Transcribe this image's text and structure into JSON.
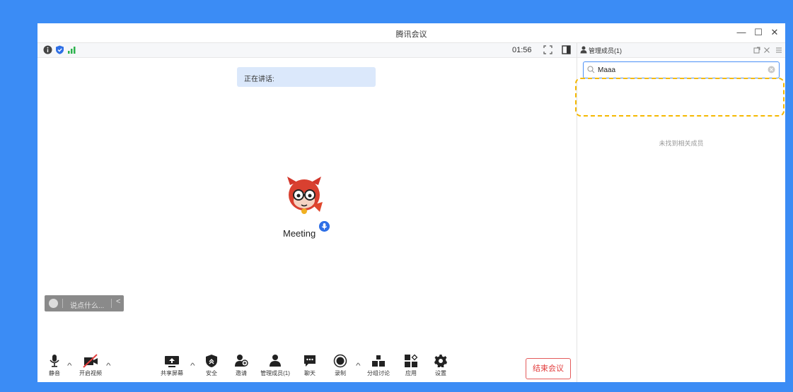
{
  "window": {
    "title": "腾讯会议",
    "controls": {
      "minimize": "—",
      "maximize": "☐",
      "close": "✕"
    }
  },
  "statusbar": {
    "timer": "01:56"
  },
  "speaking": {
    "label": "正在讲话:"
  },
  "participant": {
    "name": "Meeting"
  },
  "chat": {
    "placeholder": "说点什么...",
    "collapse": "<"
  },
  "toolbar": {
    "mute": "静音",
    "video": "开启视频",
    "share": "共享屏幕",
    "security": "安全",
    "invite": "邀请",
    "members": "管理成员(1)",
    "chat": "聊天",
    "record": "录制",
    "breakout": "分组讨论",
    "apps": "应用",
    "settings": "设置",
    "end": "结束会议"
  },
  "panel": {
    "title": "管理成员(1)",
    "search_value": "Maaa",
    "empty_text": "未找到相关成员"
  },
  "colors": {
    "accent": "#2e6fe6",
    "end": "#e23c3c",
    "highlight": "#f5b800",
    "background": "#3b8cf5"
  }
}
